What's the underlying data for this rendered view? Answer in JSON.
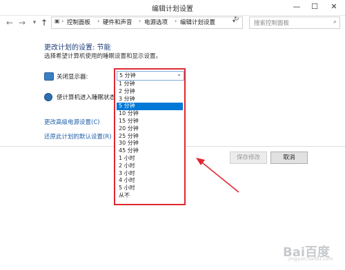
{
  "window": {
    "title": "编辑计划设置",
    "minimize": "—",
    "maximize": "☐",
    "close": "✕"
  },
  "address": {
    "crumbs": [
      "控制面板",
      "硬件和声音",
      "电源选项",
      "编辑计划设置"
    ],
    "separator": "›",
    "search_placeholder": "搜索控制面板"
  },
  "page": {
    "heading": "更改计划的设置: 节能",
    "subheading": "选择希望计算机使用的睡眠设置和显示设置。",
    "display_off_label": "关闭显示器:",
    "sleep_label": "使计算机进入睡眠状态:",
    "advanced_link": "更改高级电源设置(C)",
    "restore_link": "还原此计划的默认设置(R)",
    "save_button": "保存修改",
    "cancel_button": "取消"
  },
  "dropdown": {
    "selected": "5 分钟",
    "options": [
      "1 分钟",
      "2 分钟",
      "3 分钟",
      "5 分钟",
      "10 分钟",
      "15 分钟",
      "20 分钟",
      "25 分钟",
      "30 分钟",
      "45 分钟",
      "1 小时",
      "2 小时",
      "3 小时",
      "4 小时",
      "5 小时",
      "从不"
    ],
    "selected_index": 3
  },
  "watermark": {
    "text": "Bai百度",
    "sub": "jingyan.baidu.com"
  },
  "colors": {
    "highlight": "#0078d7",
    "annotation": "#e0262f",
    "link": "#1f5fa8",
    "heading": "#1f3d7a"
  }
}
